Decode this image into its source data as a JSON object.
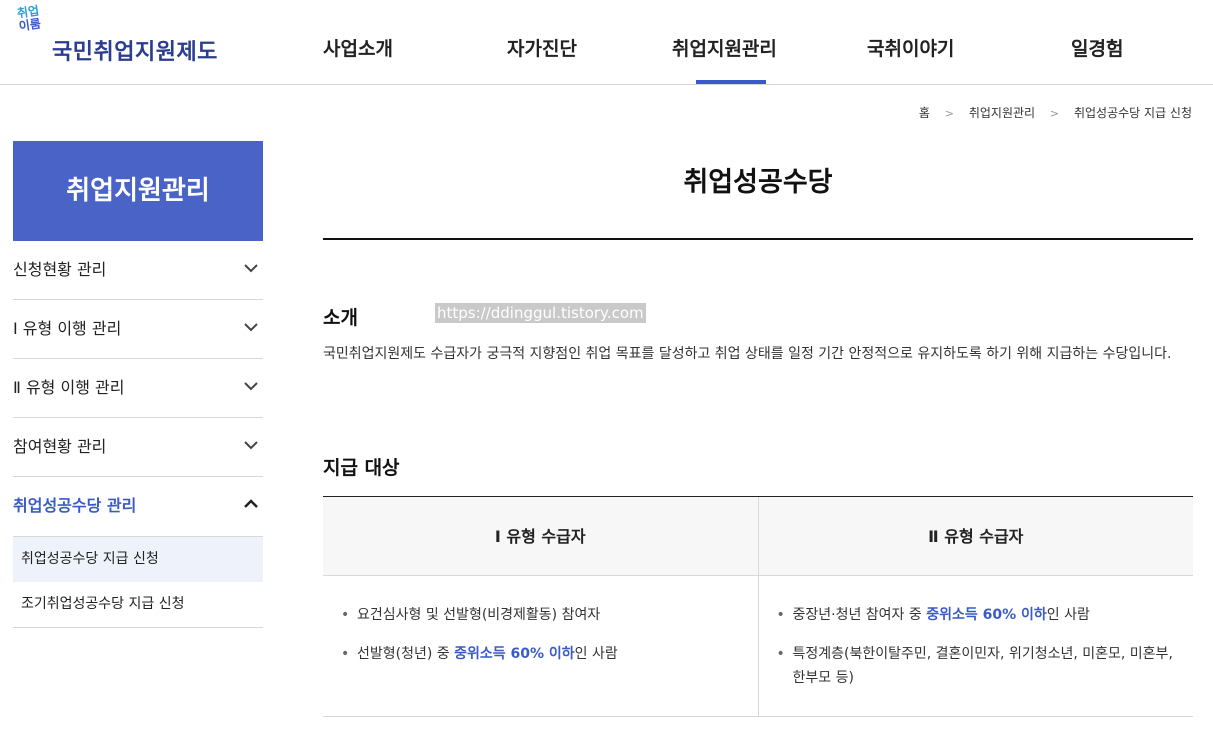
{
  "header": {
    "logo_top_1": "취업",
    "logo_top_2": "이룸",
    "logo_name": "국민취업지원제도",
    "nav": [
      "사업소개",
      "자가진단",
      "취업지원관리",
      "국취이야기",
      "일경험"
    ]
  },
  "breadcrumb": [
    "홈",
    "취업지원관리",
    "취업성공수당 지급 신청"
  ],
  "sidebar": {
    "title": "취업지원관리",
    "items": [
      {
        "label": "신청현황 관리"
      },
      {
        "label": "Ⅰ 유형 이행 관리"
      },
      {
        "label": "Ⅱ 유형 이행 관리"
      },
      {
        "label": "참여현황 관리"
      },
      {
        "label": "취업성공수당 관리"
      }
    ],
    "sub_items": [
      "취업성공수당 지급 신청",
      "조기취업성공수당 지급 신청"
    ]
  },
  "main": {
    "title": "취업성공수당",
    "intro_heading": "소개",
    "watermark": "https://ddinggul.tistory.com",
    "intro_text": "국민취업지원제도 수급자가 궁극적 지향점인 취업 목표를 달성하고 취업 상태를 일정 기간 안정적으로 유지하도록 하기 위해 지급하는 수당입니다.",
    "target_heading": "지급 대상",
    "table": {
      "headers": [
        "Ⅰ 유형 수급자",
        "Ⅱ 유형 수급자"
      ],
      "col1": {
        "item1": "요건심사형 및 선발형(비경제활동) 참여자",
        "item2_pre": "선발형(청년) 중 ",
        "item2_hl": "중위소득 60% 이하",
        "item2_post": "인 사람"
      },
      "col2": {
        "item1_pre": "중장년·청년 참여자 중 ",
        "item1_hl": "중위소득 60% 이하",
        "item1_post": "인 사람",
        "item2": "특정계층(북한이탈주민, 결혼이민자, 위기청소년, 미혼모, 미혼부, 한부모 등)"
      }
    }
  }
}
